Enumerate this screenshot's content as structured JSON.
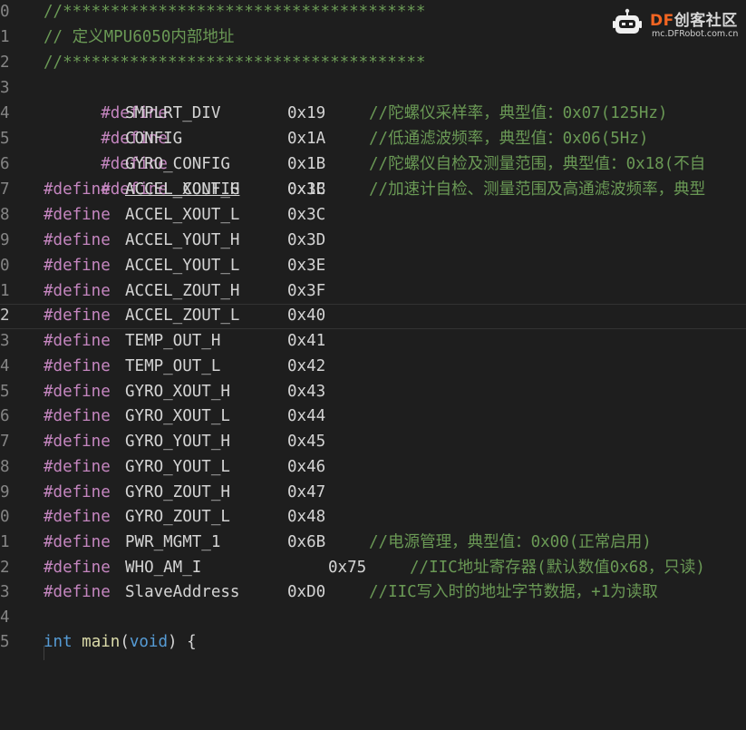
{
  "colors": {
    "background": "#1e1e1e",
    "preprocessor": "#c586c0",
    "identifier": "#d4d4d4",
    "comment": "#6a9955",
    "type_keyword": "#569cd6",
    "function": "#dcdcaa",
    "line_number": "#858585",
    "watermark_accent": "#f26522"
  },
  "watermark": {
    "brand": "DF",
    "name": "创客社区",
    "url": "mc.DFRobot.com.cn",
    "icon": "robot-logo-icon"
  },
  "editor": {
    "lines": [
      {
        "num": "0",
        "comment": "//**************************************"
      },
      {
        "num": "1",
        "comment": "// 定义MPU6050内部地址"
      },
      {
        "num": "2",
        "comment": "//**************************************"
      },
      {
        "num": "3",
        "directive": "#define",
        "name": "SMPLRT_DIV",
        "value": "0x19",
        "comment": "//陀螺仪采样率，典型值：0x07(125Hz)"
      },
      {
        "num": "4",
        "directive": "#define",
        "name": "CONFIG",
        "value": "0x1A",
        "comment": "//低通滤波频率，典型值：0x06(5Hz)"
      },
      {
        "num": "5",
        "directive": "#define",
        "name": "GYRO_CONFIG",
        "value": "0x1B",
        "comment": "//陀螺仪自检及测量范围，典型值：0x18(不自"
      },
      {
        "num": "6",
        "directive": "#define",
        "name": "ACCEL_CONFIG",
        "value": "0x1C",
        "comment": "//加速计自检、测量范围及高通滤波频率，典型"
      },
      {
        "num": "7",
        "directive": "#define",
        "name": "ACCEL_XOUT_H",
        "value": "0x3B",
        "comment": ""
      },
      {
        "num": "8",
        "directive": "#define",
        "name": "ACCEL_XOUT_L",
        "value": "0x3C",
        "comment": ""
      },
      {
        "num": "9",
        "directive": "#define",
        "name": "ACCEL_YOUT_H",
        "value": "0x3D",
        "comment": ""
      },
      {
        "num": "0",
        "directive": "#define",
        "name": "ACCEL_YOUT_L",
        "value": "0x3E",
        "comment": ""
      },
      {
        "num": "1",
        "directive": "#define",
        "name": "ACCEL_ZOUT_H",
        "value": "0x3F",
        "comment": ""
      },
      {
        "num": "2",
        "directive": "#define",
        "name": "ACCEL_ZOUT_L",
        "value": "0x40",
        "comment": ""
      },
      {
        "num": "3",
        "directive": "#define",
        "name": "TEMP_OUT_H",
        "value": "0x41",
        "comment": ""
      },
      {
        "num": "4",
        "directive": "#define",
        "name": "TEMP_OUT_L",
        "value": "0x42",
        "comment": ""
      },
      {
        "num": "5",
        "directive": "#define",
        "name": "GYRO_XOUT_H",
        "value": "0x43",
        "comment": ""
      },
      {
        "num": "6",
        "directive": "#define",
        "name": "GYRO_XOUT_L",
        "value": "0x44",
        "comment": ""
      },
      {
        "num": "7",
        "directive": "#define",
        "name": "GYRO_YOUT_H",
        "value": "0x45",
        "comment": ""
      },
      {
        "num": "8",
        "directive": "#define",
        "name": "GYRO_YOUT_L",
        "value": "0x46",
        "comment": ""
      },
      {
        "num": "9",
        "directive": "#define",
        "name": "GYRO_ZOUT_H",
        "value": "0x47",
        "comment": ""
      },
      {
        "num": "0",
        "directive": "#define",
        "name": "GYRO_ZOUT_L",
        "value": "0x48",
        "comment": ""
      },
      {
        "num": "1",
        "directive": "#define",
        "name": "PWR_MGMT_1",
        "value": "0x6B",
        "comment": "//电源管理，典型值：0x00(正常启用)"
      },
      {
        "num": "2",
        "directive": "#define",
        "name": "WHO_AM_I",
        "value": "0x75",
        "comment": "//IIC地址寄存器(默认数值0x68，只读)"
      },
      {
        "num": "3",
        "directive": "#define",
        "name": "SlaveAddress",
        "value": "0xD0",
        "comment": "//IIC写入时的地址字节数据，+1为读取"
      },
      {
        "num": "4"
      },
      {
        "num": "5",
        "main": {
          "type": "int",
          "fn": "main",
          "param": "void",
          "brace": "{",
          "open": "(",
          "close": ")"
        }
      }
    ]
  }
}
